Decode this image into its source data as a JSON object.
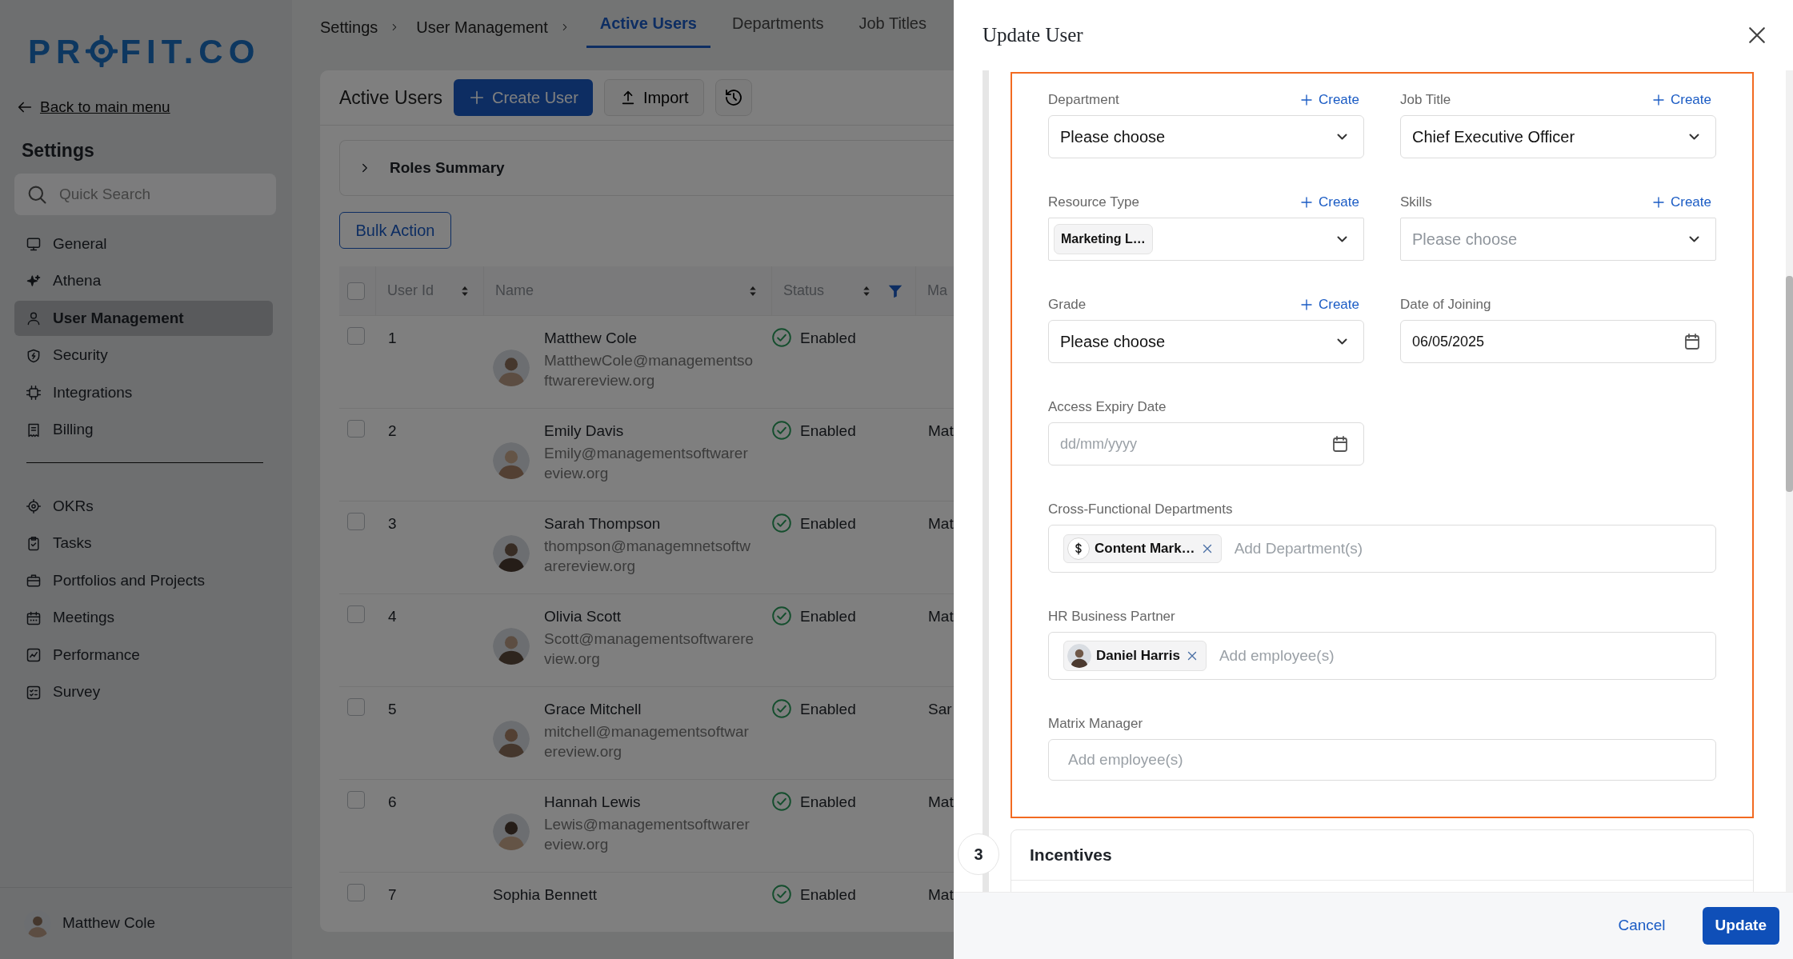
{
  "logo": {
    "text_start": "PR",
    "text_end": "FIT.CO"
  },
  "back_link": "Back to main menu",
  "sidebar": {
    "title": "Settings",
    "search": {
      "placeholder": "Quick Search"
    },
    "groups": [
      [
        {
          "label": "General",
          "selected": false
        },
        {
          "label": "Athena",
          "selected": false
        },
        {
          "label": "User Management",
          "selected": true
        },
        {
          "label": "Security",
          "selected": false
        },
        {
          "label": "Integrations",
          "selected": false
        },
        {
          "label": "Billing",
          "selected": false
        }
      ],
      [
        {
          "label": "OKRs",
          "selected": false
        },
        {
          "label": "Tasks",
          "selected": false
        },
        {
          "label": "Portfolios and Projects",
          "selected": false
        },
        {
          "label": "Meetings",
          "selected": false
        },
        {
          "label": "Performance",
          "selected": false
        },
        {
          "label": "Survey",
          "selected": false
        }
      ]
    ],
    "user": {
      "name": "Matthew Cole"
    }
  },
  "breadcrumb": [
    "Settings",
    "User Management"
  ],
  "tabs": [
    {
      "label": "Active Users",
      "selected": true
    },
    {
      "label": "Departments",
      "selected": false
    },
    {
      "label": "Job Titles",
      "selected": false
    }
  ],
  "card": {
    "title": "Active Users",
    "create_button": "Create User",
    "import_button": "Import",
    "roles_summary": {
      "label": "Roles Summary",
      "expanded": false
    },
    "bulk_action": "Bulk Action"
  },
  "table": {
    "select_all": {
      "checked": false
    },
    "columns": [
      {
        "label": "User Id",
        "sortable": true,
        "filtered": false
      },
      {
        "label": "Name",
        "sortable": true,
        "filtered": false
      },
      {
        "label": "Status",
        "sortable": true,
        "filtered": true
      },
      {
        "label": "Ma",
        "sortable": false,
        "filtered": false
      }
    ],
    "rows": [
      {
        "checked": false,
        "id": "1",
        "name": "Matthew Cole",
        "email": "MatthewCole@managementsoftwarereview.org",
        "status": "Enabled"
      },
      {
        "checked": false,
        "id": "2",
        "name": "Emily Davis",
        "email": "Emily@managementsoftwarereview.org",
        "status": "Enabled",
        "column_4": "Mat"
      },
      {
        "checked": false,
        "id": "3",
        "name": "Sarah Thompson",
        "email": "thompson@managemnetsoftwarereview.org",
        "status": "Enabled",
        "column_4": "Mat"
      },
      {
        "checked": false,
        "id": "4",
        "name": "Olivia Scott",
        "email": "Scott@managementsoftwarereview.org",
        "status": "Enabled",
        "column_4": "Mat"
      },
      {
        "checked": false,
        "id": "5",
        "name": "Grace Mitchell",
        "email": "mitchell@managementsoftwarereview.org",
        "status": "Enabled",
        "column_4": "Sar"
      },
      {
        "checked": false,
        "id": "6",
        "name": "Hannah Lewis",
        "email": "Lewis@managementsoftwarereview.org",
        "status": "Enabled",
        "column_4": "Mat"
      },
      {
        "checked": false,
        "id": "7",
        "name": "Sophia Bennett",
        "status": "Enabled",
        "column_4": "Mat"
      }
    ]
  },
  "drawer": {
    "title": "Update User",
    "fields": [
      {
        "kind": "select",
        "label": "Department",
        "create": "Create",
        "value": "Please choose"
      },
      {
        "kind": "select",
        "label": "Job Title",
        "create": "Create",
        "value": "Chief Executive Officer"
      },
      {
        "kind": "chip-select",
        "label": "Resource Type",
        "create": "Create",
        "chips": [
          "Marketing L…"
        ]
      },
      {
        "kind": "select",
        "label": "Skills",
        "create": "Create",
        "placeholder": "Please choose"
      },
      {
        "kind": "select",
        "label": "Grade",
        "create": "Create",
        "value": "Please choose"
      },
      {
        "kind": "date",
        "label": "Date of Joining",
        "value": "06/05/2025"
      },
      {
        "kind": "date",
        "label": "Access Expiry Date",
        "placeholder": "dd/mm/yyyy"
      },
      {
        "kind": "tags",
        "label": "Cross-Functional Departments",
        "tags": [
          "Content Mark…"
        ],
        "placeholder": "Add Department(s)"
      },
      {
        "kind": "people",
        "label": "HR Business Partner",
        "tags": [
          "Daniel Harris"
        ],
        "placeholder": "Add employee(s)"
      },
      {
        "kind": "people",
        "label": "Matrix Manager",
        "placeholder": "Add employee(s)"
      }
    ],
    "step": {
      "number": "3",
      "title": "Incentives"
    },
    "cancel": "Cancel",
    "submit": "Update"
  }
}
